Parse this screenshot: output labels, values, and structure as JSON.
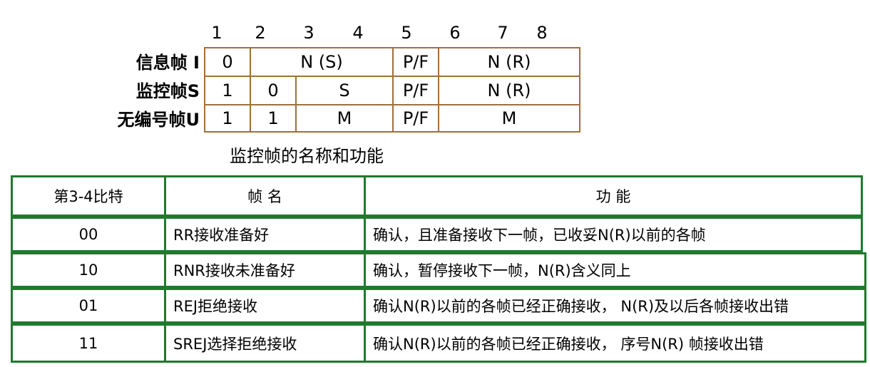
{
  "bit_numbers": [
    "1",
    "2",
    "3",
    "4",
    "5",
    "6",
    "7",
    "8"
  ],
  "frames": [
    {
      "label": "信息帧 I",
      "fields": [
        "0",
        "N (S)",
        "P/F",
        "N (R)"
      ]
    },
    {
      "label": "监控帧S",
      "fields": [
        "1",
        "0",
        "S",
        "P/F",
        "N (R)"
      ]
    },
    {
      "label": "无编号帧U",
      "fields": [
        "1",
        "1",
        "M",
        "P/F",
        "M"
      ]
    }
  ],
  "caption": "监控帧的名称和功能",
  "table": {
    "headers": [
      "第3-4比特",
      "帧 名",
      "功 能"
    ],
    "rows": [
      [
        "00",
        "RR接收准备好",
        "确认，且准备接收下一帧，已收妥N(R)以前的各帧"
      ],
      [
        "10",
        "RNR接收未准备好",
        "确认，暂停接收下一帧，N(R)含义同上"
      ],
      [
        "01",
        "REJ拒绝接收",
        "确认N(R)以前的各帧已经正确接收， N(R)及以后各帧接收出错"
      ],
      [
        "11",
        "SREJ选择拒绝接收",
        "确认N(R)以前的各帧已经正确接收， 序号N(R) 帧接收出错"
      ]
    ]
  },
  "colors": {
    "frame_border": "#a0703a",
    "table_border": "#1f7a2e"
  }
}
